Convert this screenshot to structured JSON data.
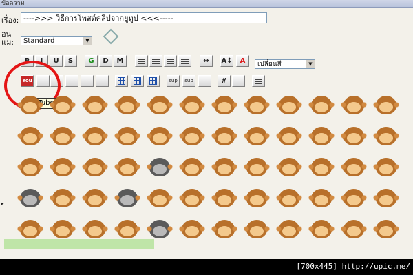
{
  "window": {
    "title_fragment": "ข้อความ"
  },
  "form": {
    "subject_label": "เรื่อง:",
    "subject_value": "---->>> วิธีการโพสต์คลิปจากยูทูป <<<-----",
    "style_label": "อน\nแม:",
    "style_select": "Standard",
    "font_select": "เปลี่ยนสี"
  },
  "toolbar": {
    "row1": [
      {
        "name": "bold-button",
        "label": "B"
      },
      {
        "name": "italic-button",
        "label": "I"
      },
      {
        "name": "underline-button",
        "label": "U"
      },
      {
        "name": "strike-button",
        "label": "S"
      },
      {
        "name": "glow-button",
        "label": "G"
      },
      {
        "name": "shadow-button",
        "label": "D"
      },
      {
        "name": "marquee-button",
        "label": "M"
      },
      {
        "name": "align-left-button",
        "label": ""
      },
      {
        "name": "align-center-button",
        "label": ""
      },
      {
        "name": "align-right-button",
        "label": ""
      },
      {
        "name": "justify-button",
        "label": ""
      },
      {
        "name": "horizontal-rule-button",
        "label": "↔"
      },
      {
        "name": "font-size-button",
        "label": "A↕"
      },
      {
        "name": "font-color-button",
        "label": "A"
      }
    ],
    "row2": [
      {
        "name": "youtube-button",
        "label": "You"
      },
      {
        "name": "flash-button",
        "label": ""
      },
      {
        "name": "image-button",
        "label": ""
      },
      {
        "name": "link-button",
        "label": ""
      },
      {
        "name": "email-button",
        "label": ""
      },
      {
        "name": "quote-button",
        "label": ""
      },
      {
        "name": "table-button",
        "label": ""
      },
      {
        "name": "table-row-button",
        "label": ""
      },
      {
        "name": "table-column-button",
        "label": ""
      },
      {
        "name": "superscript-button",
        "label": "sup"
      },
      {
        "name": "subscript-button",
        "label": "sub"
      },
      {
        "name": "teletype-button",
        "label": ""
      },
      {
        "name": "code-button",
        "label": "#"
      },
      {
        "name": "quote-box-button",
        "label": ""
      },
      {
        "name": "list-button",
        "label": ""
      }
    ],
    "tooltip": "YouTube"
  },
  "overlay": {
    "resolution_text": "[700x445] http://upic.me/"
  },
  "colors": {
    "annotation_circle": "#e41515",
    "bar": "#bfe5a8"
  }
}
